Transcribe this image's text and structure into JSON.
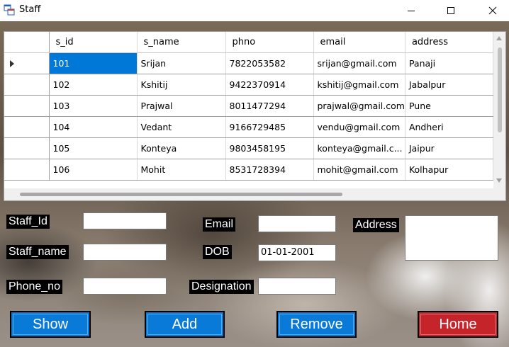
{
  "window": {
    "title": "Staff"
  },
  "grid": {
    "columns": [
      "s_id",
      "s_name",
      "phno",
      "email",
      "address"
    ],
    "rows": [
      [
        "101",
        "Srijan",
        "7822053582",
        "srijan@gmail.com",
        "Panaji"
      ],
      [
        "102",
        "Kshitij",
        "9422370914",
        "kshitij@gmail.com",
        "Jabalpur"
      ],
      [
        "103",
        "Prajwal",
        "8011477294",
        "prajwal@gmail.com",
        "Pune"
      ],
      [
        "104",
        "Vedant",
        "9166729485",
        "vendu@gmail.com",
        "Andheri"
      ],
      [
        "105",
        "Konteya",
        "9803458195",
        "konteya@gmail.c...",
        "Jaipur"
      ],
      [
        "106",
        "Mohit",
        "8531728394",
        "mohit@gmail.com",
        "Kolhapur"
      ]
    ],
    "selected_row": 0
  },
  "form": {
    "staff_id_label": "Staff_Id",
    "staff_name_label": "Staff_name",
    "phone_label": "Phone_no",
    "email_label": "Email",
    "dob_label": "DOB",
    "designation_label": "Designation",
    "address_label": "Address",
    "staff_id_value": "",
    "staff_name_value": "",
    "phone_value": "",
    "email_value": "",
    "dob_value": "01-01-2001",
    "designation_value": "",
    "address_value": ""
  },
  "buttons": {
    "show_label": "Show",
    "add_label": "Add",
    "remove_label": "Remove",
    "home_label": "Home"
  },
  "colors": {
    "primary_button": "#0a7ad8",
    "home_button": "#c4242a",
    "selection": "#0078d7"
  },
  "icons": {
    "app": "app-window-icon",
    "minimize": "minimize-icon",
    "maximize": "maximize-icon",
    "close": "close-icon"
  }
}
